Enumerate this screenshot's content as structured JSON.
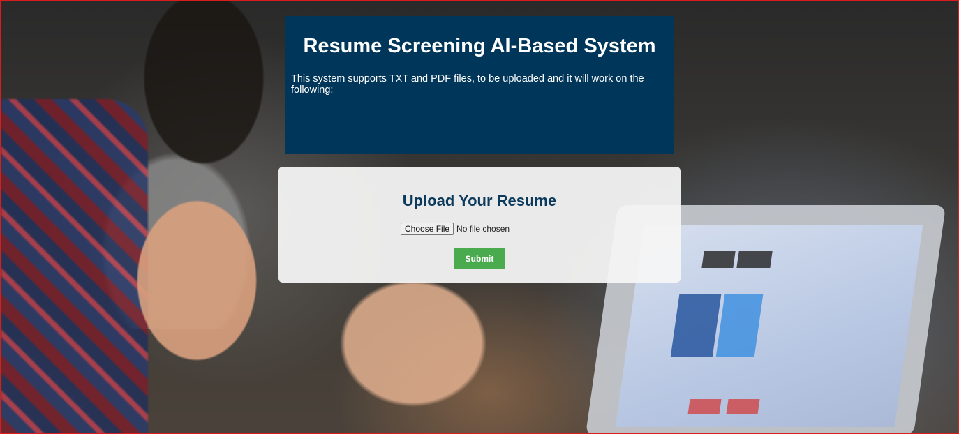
{
  "header": {
    "title": "Resume Screening AI-Based System",
    "description": "This system supports TXT and PDF files, to be uploaded and it will work on the following:"
  },
  "upload": {
    "title": "Upload Your Resume",
    "choose_file_label": "Choose File",
    "file_status": "No file chosen",
    "submit_label": "Submit"
  },
  "colors": {
    "header_bg": "#003659",
    "title_text": "#0b3a5c",
    "submit_bg": "#4aab4e",
    "frame_border": "#d91c1c"
  }
}
